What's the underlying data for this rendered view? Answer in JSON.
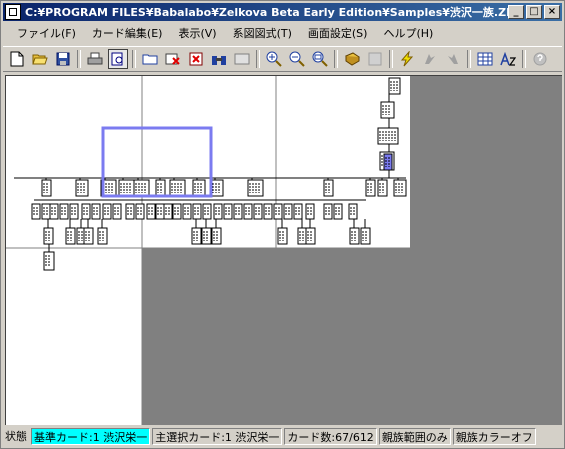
{
  "window": {
    "title": "C:¥PROGRAM FILES¥Babalabo¥Zelkova Beta Early Edition¥Samples¥渋沢一族.ZEL",
    "minimize_label": "_",
    "maximize_label": "□",
    "close_label": "×"
  },
  "menubar": {
    "items": [
      {
        "label": "ファイル(F)"
      },
      {
        "label": "カード編集(E)"
      },
      {
        "label": "表示(V)"
      },
      {
        "label": "系図図式(T)"
      },
      {
        "label": "画面設定(S)"
      },
      {
        "label": "ヘルプ(H)"
      }
    ]
  },
  "toolbar": {
    "groups": [
      [
        "new-icon",
        "open-icon",
        "save-icon"
      ],
      [
        "print-icon",
        "preview-icon"
      ],
      [
        "folder-icon",
        "delete-card-icon",
        "delete-icon",
        "find-icon",
        "id-card-icon"
      ],
      [
        "zoom-in-icon",
        "zoom-out-icon",
        "zoom-fit-icon"
      ],
      [
        "book-icon",
        "list-icon"
      ],
      [
        "lightning-icon",
        "arrow-left-icon",
        "arrow-right-icon"
      ],
      [
        "grid-icon",
        "font-icon"
      ],
      [
        "help-icon"
      ]
    ]
  },
  "statusbar": {
    "state_label": "状態",
    "base_card": "基準カード:1 渋沢栄一",
    "selected_card": "主選択カード:1 渋沢栄一",
    "card_count": "カード数:67/612",
    "scope": "親族範囲のみ",
    "color": "親族カラーオフ"
  },
  "colors": {
    "selection_frame": "#7b7bf0",
    "statusbar_highlight": "#00ffff",
    "canvas_background": "#808080"
  }
}
